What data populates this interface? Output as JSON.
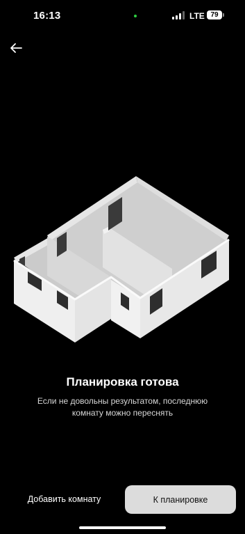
{
  "status_bar": {
    "time": "16:13",
    "network": "LTE",
    "battery": "79"
  },
  "icons": {
    "back": "arrow-left-icon",
    "signal": "signal-icon",
    "battery": "battery-icon"
  },
  "result": {
    "title": "Планировка готова",
    "subtitle": "Если не довольны результатом, последнюю комнату можно переснять"
  },
  "actions": {
    "add_room_label": "Добавить комнату",
    "to_plan_label": "К планировке"
  },
  "colors": {
    "background": "#000000",
    "primary_button": "#dcdcdc",
    "text": "#ffffff"
  }
}
